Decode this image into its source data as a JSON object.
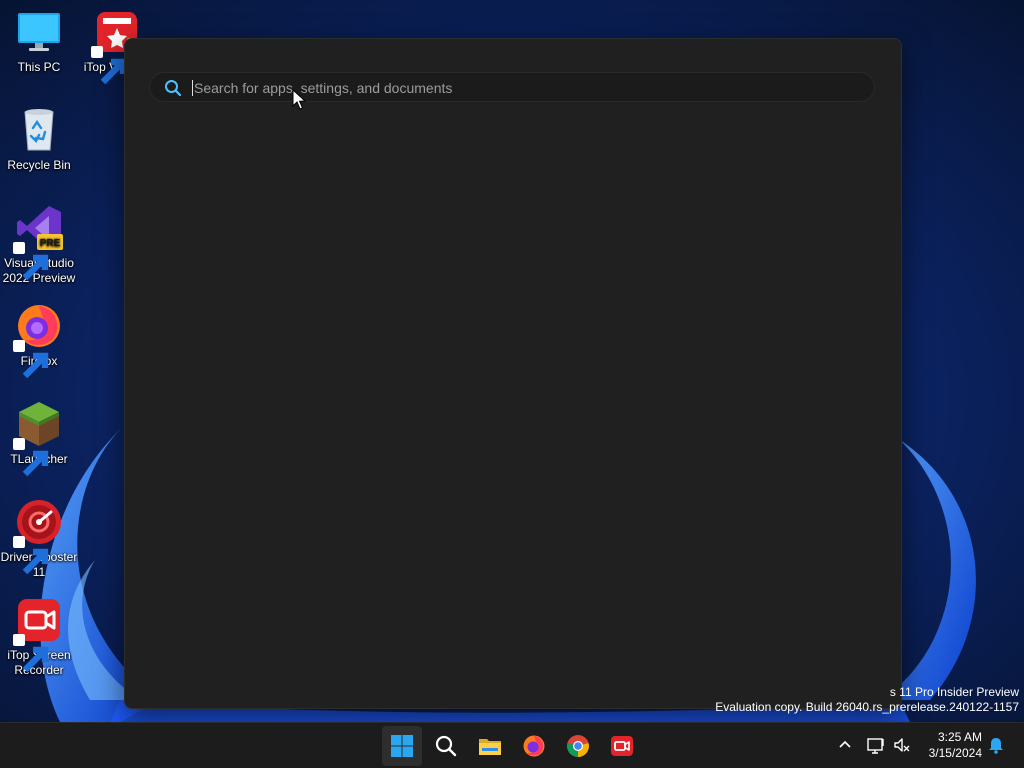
{
  "desktop": {
    "icons": [
      {
        "label": "This PC",
        "icon": "monitor-icon"
      },
      {
        "label": "Recycle Bin",
        "icon": "recycle-bin-icon"
      },
      {
        "label": "Visual Studio 2022 Preview",
        "icon": "visual-studio-icon",
        "badge": "PRE"
      },
      {
        "label": "Firefox",
        "icon": "firefox-icon"
      },
      {
        "label": "TLauncher",
        "icon": "minecraft-block-icon"
      },
      {
        "label": "Driver Booster 11",
        "icon": "driver-booster-icon"
      },
      {
        "label": "iTop Screen Recorder",
        "icon": "screen-recorder-icon"
      },
      {
        "label": "iTop Vi Edito",
        "icon": "video-editor-icon"
      }
    ]
  },
  "search": {
    "placeholder": "Search for apps, settings, and documents",
    "value": ""
  },
  "watermark": {
    "line1": "s 11 Pro Insider Preview",
    "line2": "Evaluation copy. Build 26040.rs_prerelease.240122-1157"
  },
  "taskbar": {
    "pinned": [
      {
        "name": "start",
        "icon": "windows-logo-icon",
        "active": true
      },
      {
        "name": "search",
        "icon": "search-icon"
      },
      {
        "name": "file-explorer",
        "icon": "folder-icon"
      },
      {
        "name": "firefox",
        "icon": "firefox-icon"
      },
      {
        "name": "chrome",
        "icon": "chrome-icon"
      },
      {
        "name": "itop-screen-recorder",
        "icon": "screen-recorder-icon"
      }
    ],
    "tray": {
      "time": "3:25 AM",
      "date": "3/15/2024"
    }
  },
  "colors": {
    "panel_bg": "#202020",
    "taskbar_bg": "#1c1c1c",
    "accent": "#4cc2ff",
    "wallpaper_dark": "#0a1a3a",
    "wallpaper_bloom": "#1e6fff"
  }
}
